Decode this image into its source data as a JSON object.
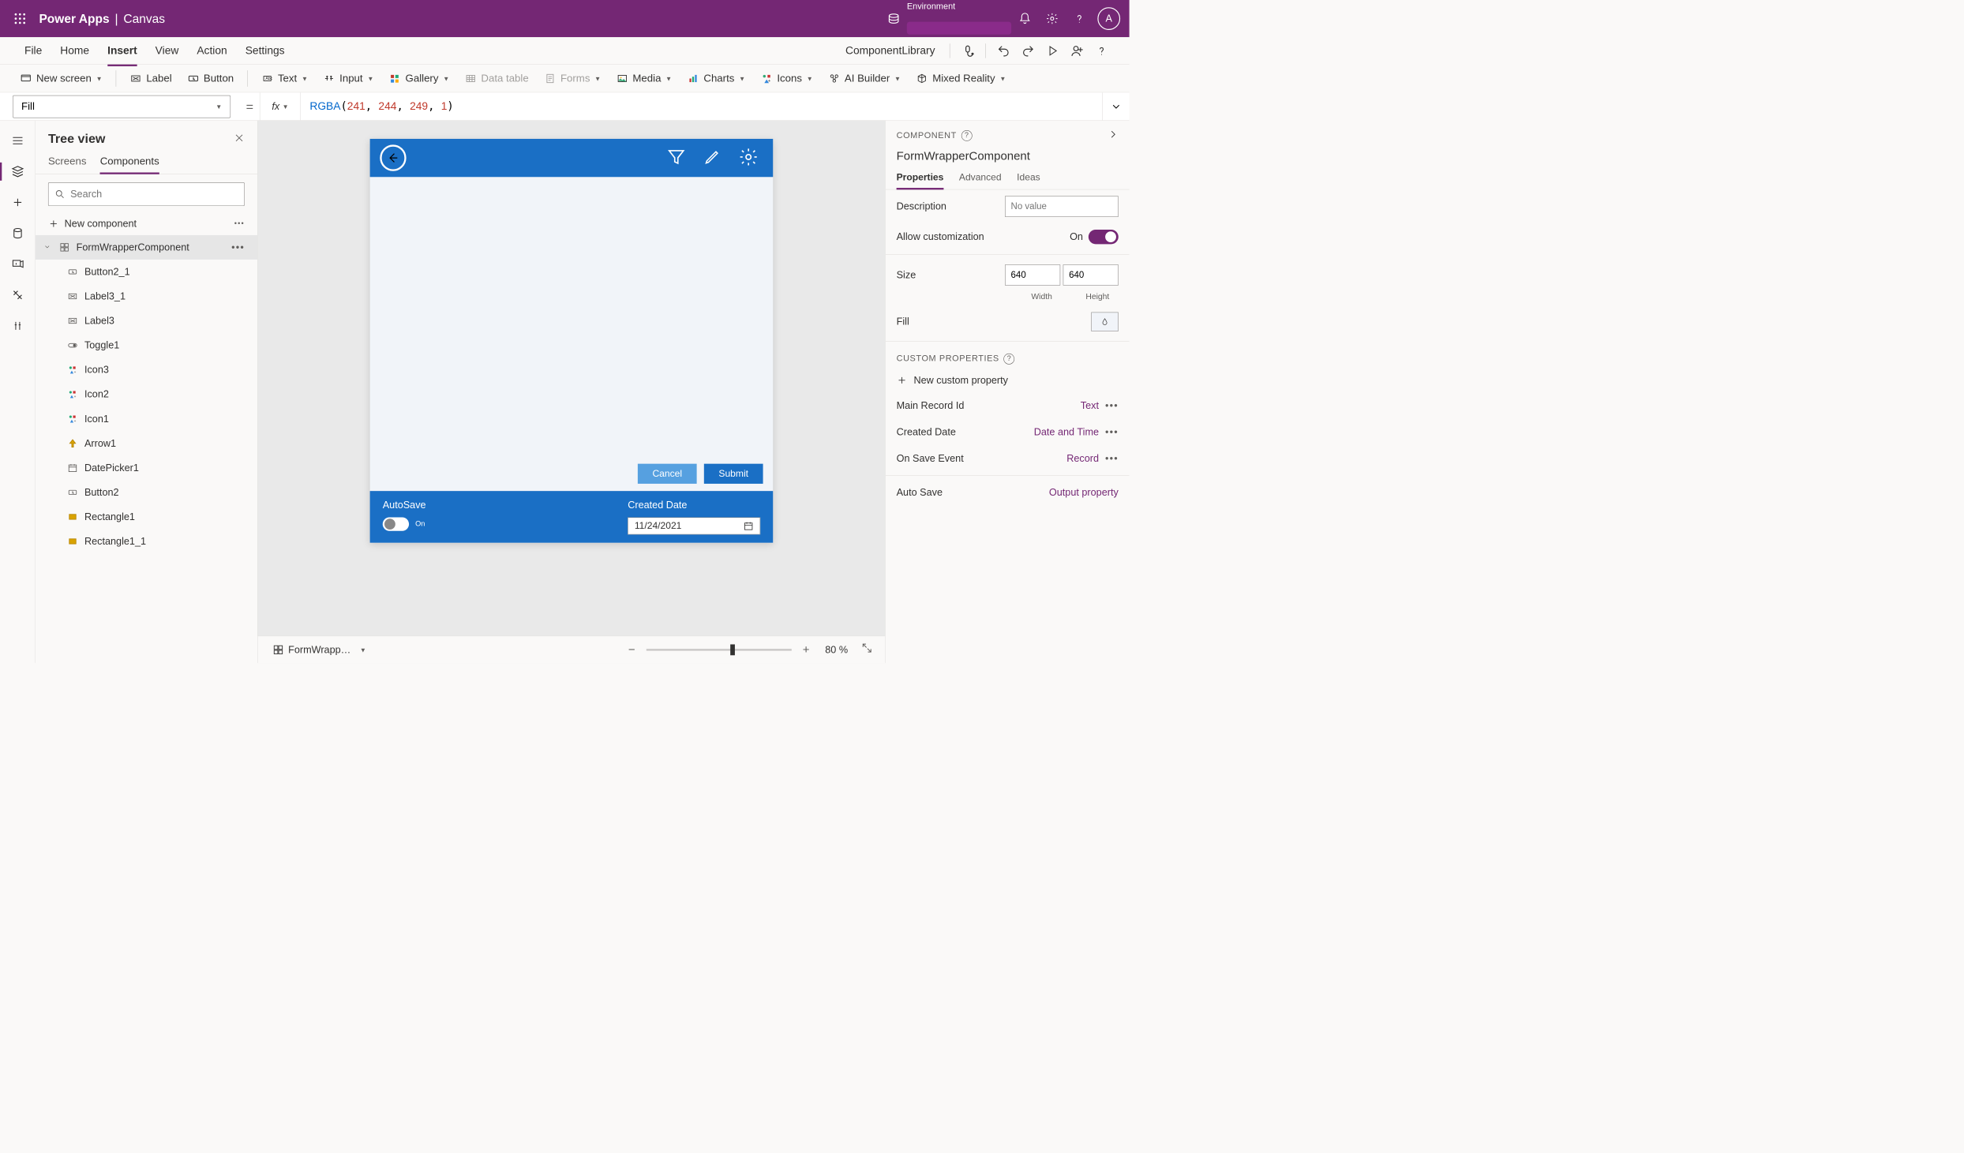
{
  "titlebar": {
    "brand": "Power Apps",
    "sub": "Canvas",
    "env_label": "Environment",
    "avatar_initial": "A"
  },
  "menubar": {
    "items": [
      "File",
      "Home",
      "Insert",
      "View",
      "Action",
      "Settings"
    ],
    "active_index": 2,
    "right_label": "ComponentLibrary"
  },
  "ribbon": {
    "new_screen": "New screen",
    "label": "Label",
    "button": "Button",
    "text": "Text",
    "input": "Input",
    "gallery": "Gallery",
    "data_table": "Data table",
    "forms": "Forms",
    "media": "Media",
    "charts": "Charts",
    "icons": "Icons",
    "ai_builder": "AI Builder",
    "mixed_reality": "Mixed Reality"
  },
  "formulabar": {
    "property": "Fill",
    "formula_fn": "RGBA",
    "formula_args": [
      "241",
      "244",
      "249",
      "1"
    ]
  },
  "tree": {
    "title": "Tree view",
    "tabs": [
      "Screens",
      "Components"
    ],
    "active_tab_index": 1,
    "search_placeholder": "Search",
    "new_component": "New component",
    "root": "FormWrapperComponent",
    "children": [
      {
        "name": "Button2_1",
        "icon": "button-icon"
      },
      {
        "name": "Label3_1",
        "icon": "label-icon"
      },
      {
        "name": "Label3",
        "icon": "label-icon"
      },
      {
        "name": "Toggle1",
        "icon": "toggle-icon"
      },
      {
        "name": "Icon3",
        "icon": "icon-icon"
      },
      {
        "name": "Icon2",
        "icon": "icon-icon"
      },
      {
        "name": "Icon1",
        "icon": "icon-icon"
      },
      {
        "name": "Arrow1",
        "icon": "arrow-icon"
      },
      {
        "name": "DatePicker1",
        "icon": "calendar-icon"
      },
      {
        "name": "Button2",
        "icon": "button-icon"
      },
      {
        "name": "Rectangle1",
        "icon": "rect-icon"
      },
      {
        "name": "Rectangle1_1",
        "icon": "rect-icon"
      }
    ]
  },
  "canvas": {
    "footer": {
      "autosave_label": "AutoSave",
      "toggle_text": "On",
      "created_date_label": "Created Date",
      "created_date_value": "11/24/2021"
    },
    "buttons": {
      "cancel": "Cancel",
      "submit": "Submit"
    },
    "status_selector": "FormWrapp…",
    "zoom_value": "80",
    "zoom_unit": "%"
  },
  "props": {
    "head_label": "Component",
    "name": "FormWrapperComponent",
    "tabs": [
      "Properties",
      "Advanced",
      "Ideas"
    ],
    "active_tab_index": 0,
    "description_label": "Description",
    "description_placeholder": "No value",
    "allow_custom_label": "Allow customization",
    "allow_custom_value": "On",
    "size_label": "Size",
    "width_value": "640",
    "height_value": "640",
    "width_label": "Width",
    "height_label": "Height",
    "fill_label": "Fill",
    "custom_section": "Custom Properties",
    "new_custom_prop": "New custom property",
    "custom_props": [
      {
        "name": "Main Record Id",
        "type": "Text",
        "dots": true
      },
      {
        "name": "Created Date",
        "type": "Date and Time",
        "dots": true
      },
      {
        "name": "On Save Event",
        "type": "Record",
        "dots": true
      },
      {
        "name": "Auto Save",
        "type": "Output property",
        "dots": false
      }
    ]
  }
}
